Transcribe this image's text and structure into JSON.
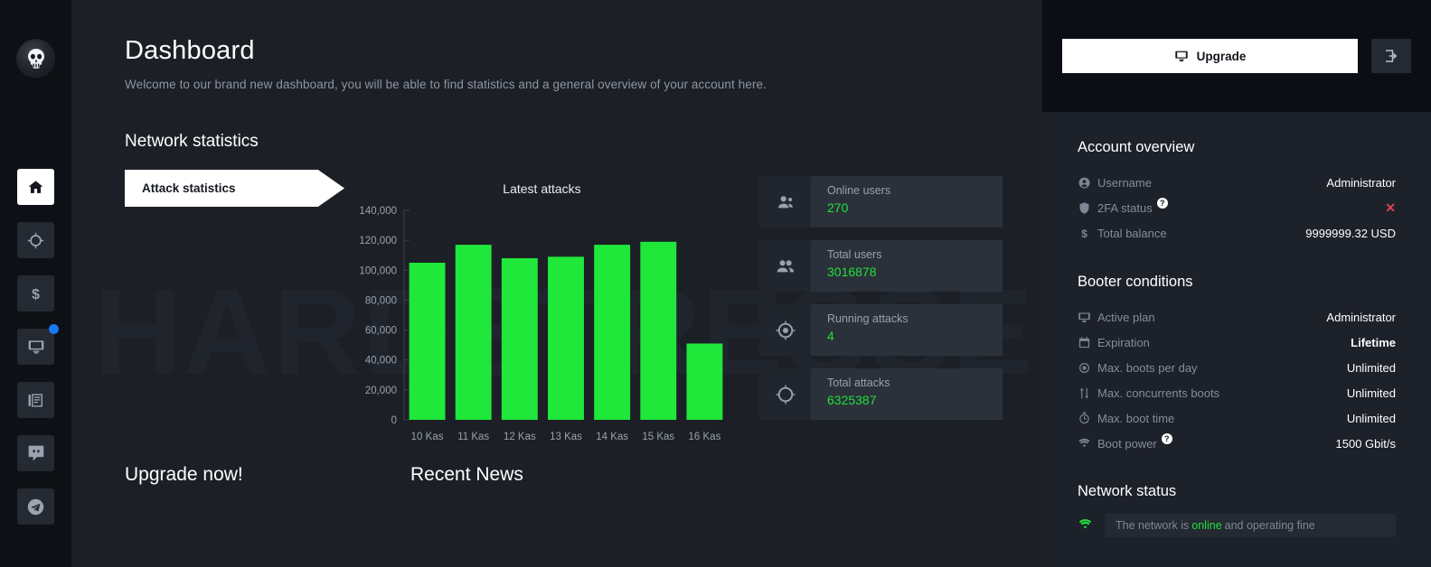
{
  "sidebar": {
    "logo_icon": "skull-logo-icon",
    "items": [
      {
        "icon": "home-icon",
        "name": "home",
        "active": true,
        "badge": false
      },
      {
        "icon": "crosshair-icon",
        "name": "attack-hub",
        "active": false,
        "badge": false
      },
      {
        "icon": "dollar-icon",
        "name": "billing",
        "active": false,
        "badge": false
      },
      {
        "icon": "monitor-icon",
        "name": "plans",
        "active": false,
        "badge": true
      },
      {
        "icon": "news-icon",
        "name": "news",
        "active": false,
        "badge": false
      },
      {
        "icon": "discord-icon",
        "name": "discord",
        "active": false,
        "badge": false
      },
      {
        "icon": "telegram-icon",
        "name": "telegram",
        "active": false,
        "badge": false
      }
    ]
  },
  "main": {
    "watermark": "HARDSTRESSER",
    "title": "Dashboard",
    "subtitle": "Welcome to our brand new dashboard, you will be able to find statistics and a general overview of your account here.",
    "section_title": "Network statistics",
    "tab_label": "Attack statistics",
    "cards": [
      {
        "icon": "online-users-icon",
        "label": "Online users",
        "value": "270"
      },
      {
        "icon": "total-users-icon",
        "label": "Total users",
        "value": "3016878"
      },
      {
        "icon": "running-attacks-icon",
        "label": "Running attacks",
        "value": "4"
      },
      {
        "icon": "total-attacks-icon",
        "label": "Total attacks",
        "value": "6325387"
      }
    ],
    "bottom_left_heading": "Upgrade now!",
    "bottom_right_heading": "Recent News"
  },
  "chart_data": {
    "type": "bar",
    "title": "Latest attacks",
    "xlabel": "",
    "ylabel": "",
    "categories": [
      "10 Kas",
      "11 Kas",
      "12 Kas",
      "13 Kas",
      "14 Kas",
      "15 Kas",
      "16 Kas"
    ],
    "values": [
      105000,
      117000,
      108000,
      109000,
      117000,
      119000,
      51000
    ],
    "ylim": [
      0,
      140000
    ],
    "yticks": [
      0,
      20000,
      40000,
      60000,
      80000,
      100000,
      120000,
      140000
    ],
    "ytick_labels": [
      "0",
      "20,000",
      "40,000",
      "60,000",
      "80,000",
      "100,000",
      "120,000",
      "140,000"
    ],
    "bar_color": "#1FE83B",
    "grid": false,
    "legend": "none"
  },
  "right": {
    "upgrade_label": "Upgrade",
    "upgrade_icon": "monitor-icon",
    "logout_icon": "logout-icon",
    "account": {
      "heading": "Account overview",
      "rows": [
        {
          "icon": "user-icon",
          "key": "Username",
          "value": "Administrator",
          "help": false,
          "style": ""
        },
        {
          "icon": "shield-icon",
          "key": "2FA status",
          "value": "✕",
          "help": true,
          "style": "red"
        },
        {
          "icon": "dollar-icon",
          "key": "Total balance",
          "value": "9999999.32 USD",
          "help": false,
          "style": ""
        }
      ]
    },
    "booter": {
      "heading": "Booter conditions",
      "rows": [
        {
          "icon": "monitor-icon",
          "key": "Active plan",
          "value": "Administrator",
          "help": false,
          "style": ""
        },
        {
          "icon": "calendar-icon",
          "key": "Expiration",
          "value": "Lifetime",
          "help": false,
          "style": "bold"
        },
        {
          "icon": "target-icon",
          "key": "Max. boots per day",
          "value": "Unlimited",
          "help": false,
          "style": ""
        },
        {
          "icon": "arrows-updown-icon",
          "key": "Max. concurrents boots",
          "value": "Unlimited",
          "help": false,
          "style": ""
        },
        {
          "icon": "stopwatch-icon",
          "key": "Max. boot time",
          "value": "Unlimited",
          "help": false,
          "style": ""
        },
        {
          "icon": "wifi-icon",
          "key": "Boot power",
          "value": "1500 Gbit/s",
          "help": true,
          "style": ""
        }
      ]
    },
    "network": {
      "heading": "Network status",
      "icon": "wifi-icon",
      "text_before": "The network is",
      "status_word": "online",
      "text_after": "and operating fine"
    },
    "help_glyph": "?"
  },
  "colors": {
    "accent_green": "#20E03C",
    "danger_red": "#e0454f",
    "badge_blue": "#1877F2"
  }
}
